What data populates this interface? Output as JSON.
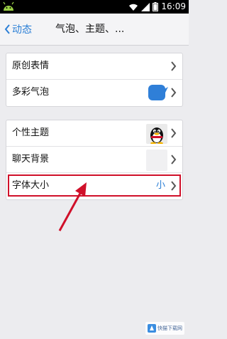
{
  "status_bar": {
    "time": "16:09"
  },
  "nav": {
    "back_label": "动态",
    "title": "气泡、主题、..."
  },
  "group1": [
    {
      "label": "原创表情"
    },
    {
      "label": "多彩气泡"
    }
  ],
  "group2": [
    {
      "label": "个性主题"
    },
    {
      "label": "聊天背景"
    },
    {
      "label": "字体大小",
      "value": "小"
    }
  ],
  "colors": {
    "accent": "#2b7fd6",
    "highlight": "#d0102a",
    "bubble": "#2f7fd8"
  },
  "watermark": {
    "text": "快猫下载网"
  }
}
